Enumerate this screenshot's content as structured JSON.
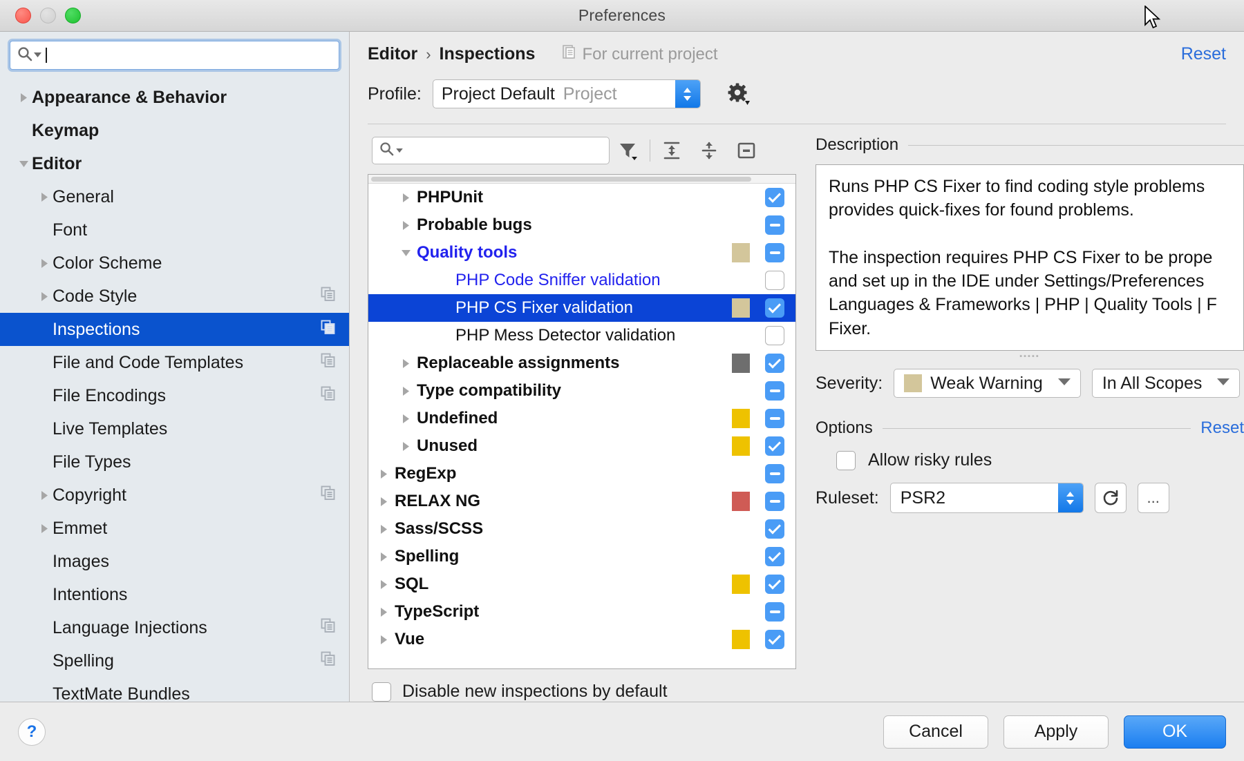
{
  "window": {
    "title": "Preferences"
  },
  "sidebar": {
    "search": {
      "placeholder": "",
      "value": ""
    },
    "items": [
      {
        "label": "Appearance & Behavior",
        "level": 0,
        "arrow": "right",
        "bold": true,
        "copy": false,
        "selected": false
      },
      {
        "label": "Keymap",
        "level": 0,
        "arrow": "none",
        "bold": true,
        "copy": false,
        "selected": false
      },
      {
        "label": "Editor",
        "level": 0,
        "arrow": "down",
        "bold": true,
        "copy": false,
        "selected": false
      },
      {
        "label": "General",
        "level": 1,
        "arrow": "right",
        "bold": false,
        "copy": false,
        "selected": false
      },
      {
        "label": "Font",
        "level": 1,
        "arrow": "none",
        "bold": false,
        "copy": false,
        "selected": false
      },
      {
        "label": "Color Scheme",
        "level": 1,
        "arrow": "right",
        "bold": false,
        "copy": false,
        "selected": false
      },
      {
        "label": "Code Style",
        "level": 1,
        "arrow": "right",
        "bold": false,
        "copy": true,
        "selected": false
      },
      {
        "label": "Inspections",
        "level": 1,
        "arrow": "none",
        "bold": false,
        "copy": true,
        "selected": true
      },
      {
        "label": "File and Code Templates",
        "level": 1,
        "arrow": "none",
        "bold": false,
        "copy": true,
        "selected": false
      },
      {
        "label": "File Encodings",
        "level": 1,
        "arrow": "none",
        "bold": false,
        "copy": true,
        "selected": false
      },
      {
        "label": "Live Templates",
        "level": 1,
        "arrow": "none",
        "bold": false,
        "copy": false,
        "selected": false
      },
      {
        "label": "File Types",
        "level": 1,
        "arrow": "none",
        "bold": false,
        "copy": false,
        "selected": false
      },
      {
        "label": "Copyright",
        "level": 1,
        "arrow": "right",
        "bold": false,
        "copy": true,
        "selected": false
      },
      {
        "label": "Emmet",
        "level": 1,
        "arrow": "right",
        "bold": false,
        "copy": false,
        "selected": false
      },
      {
        "label": "Images",
        "level": 1,
        "arrow": "none",
        "bold": false,
        "copy": false,
        "selected": false
      },
      {
        "label": "Intentions",
        "level": 1,
        "arrow": "none",
        "bold": false,
        "copy": false,
        "selected": false
      },
      {
        "label": "Language Injections",
        "level": 1,
        "arrow": "none",
        "bold": false,
        "copy": true,
        "selected": false
      },
      {
        "label": "Spelling",
        "level": 1,
        "arrow": "none",
        "bold": false,
        "copy": true,
        "selected": false
      },
      {
        "label": "TextMate Bundles",
        "level": 1,
        "arrow": "none",
        "bold": false,
        "copy": false,
        "selected": false
      }
    ]
  },
  "header": {
    "breadcrumb_parent": "Editor",
    "breadcrumb_sep": "›",
    "breadcrumb_current": "Inspections",
    "scope_note": "For current project",
    "scope_icon": "project-scope-icon",
    "reset_label": "Reset",
    "profile_label": "Profile:",
    "profile_value": "Project Default",
    "profile_suffix": "Project",
    "gear_icon": "gear-icon"
  },
  "list_toolbar": {
    "search_placeholder": "",
    "filter_icon": "filter-icon",
    "expand_all_icon": "expand-all-icon",
    "collapse_all_icon": "collapse-all-icon",
    "show_only_icon": "show-only-enabled-icon"
  },
  "tree": {
    "rows": [
      {
        "label": "PHPUnit",
        "level": 1,
        "arrow": "right",
        "bold": true,
        "check": "on",
        "severity": null,
        "style": "normal"
      },
      {
        "label": "Probable bugs",
        "level": 1,
        "arrow": "right",
        "bold": true,
        "check": "mix",
        "severity": null,
        "style": "normal"
      },
      {
        "label": "Quality tools",
        "level": 1,
        "arrow": "down",
        "bold": true,
        "check": "mix",
        "severity": "#d3c69b",
        "style": "blue"
      },
      {
        "label": "PHP Code Sniffer validation",
        "level": 2,
        "arrow": "none",
        "bold": false,
        "check": "off",
        "severity": null,
        "style": "blue"
      },
      {
        "label": "PHP CS Fixer validation",
        "level": 2,
        "arrow": "none",
        "bold": false,
        "check": "on",
        "severity": "#d3c69b",
        "style": "selected"
      },
      {
        "label": "PHP Mess Detector validation",
        "level": 2,
        "arrow": "none",
        "bold": false,
        "check": "off",
        "severity": null,
        "style": "normal"
      },
      {
        "label": "Replaceable assignments",
        "level": 1,
        "arrow": "right",
        "bold": true,
        "check": "on",
        "severity": "#6e6e6e",
        "style": "normal"
      },
      {
        "label": "Type compatibility",
        "level": 1,
        "arrow": "right",
        "bold": true,
        "check": "mix",
        "severity": null,
        "style": "normal"
      },
      {
        "label": "Undefined",
        "level": 1,
        "arrow": "right",
        "bold": true,
        "check": "mix",
        "severity": "#eec200",
        "style": "normal"
      },
      {
        "label": "Unused",
        "level": 1,
        "arrow": "right",
        "bold": true,
        "check": "on",
        "severity": "#eec200",
        "style": "normal"
      },
      {
        "label": "RegExp",
        "level": 0,
        "arrow": "right",
        "bold": true,
        "check": "mix",
        "severity": null,
        "style": "normal"
      },
      {
        "label": "RELAX NG",
        "level": 0,
        "arrow": "right",
        "bold": true,
        "check": "mix",
        "severity": "#cf5b55",
        "style": "normal"
      },
      {
        "label": "Sass/SCSS",
        "level": 0,
        "arrow": "right",
        "bold": true,
        "check": "on",
        "severity": null,
        "style": "normal"
      },
      {
        "label": "Spelling",
        "level": 0,
        "arrow": "right",
        "bold": true,
        "check": "on",
        "severity": null,
        "style": "normal"
      },
      {
        "label": "SQL",
        "level": 0,
        "arrow": "right",
        "bold": true,
        "check": "on",
        "severity": "#eec200",
        "style": "normal"
      },
      {
        "label": "TypeScript",
        "level": 0,
        "arrow": "right",
        "bold": true,
        "check": "mix",
        "severity": null,
        "style": "normal"
      },
      {
        "label": "Vue",
        "level": 0,
        "arrow": "right",
        "bold": true,
        "check": "on",
        "severity": "#eec200",
        "style": "normal"
      }
    ],
    "disable_default_label": "Disable new inspections by default",
    "disable_default_checked": false
  },
  "description": {
    "section_title": "Description",
    "lines": [
      "Runs PHP CS Fixer to find coding style problems",
      "provides quick-fixes for found problems.",
      "",
      "The inspection requires PHP CS Fixer to be prope",
      "and set up in the IDE under Settings/Preferences",
      "Languages & Frameworks | PHP | Quality Tools | F",
      "Fixer."
    ]
  },
  "severity": {
    "label": "Severity:",
    "value": "Weak Warning",
    "color": "#d3c69b",
    "scope_value": "In All Scopes"
  },
  "options": {
    "section_title": "Options",
    "reset_label": "Reset",
    "allow_risky_label": "Allow risky rules",
    "allow_risky_checked": false,
    "ruleset_label": "Ruleset:",
    "ruleset_value": "PSR2",
    "refresh_icon": "refresh-icon",
    "more_label": "..."
  },
  "footer": {
    "help_label": "?",
    "cancel_label": "Cancel",
    "apply_label": "Apply",
    "ok_label": "OK"
  }
}
